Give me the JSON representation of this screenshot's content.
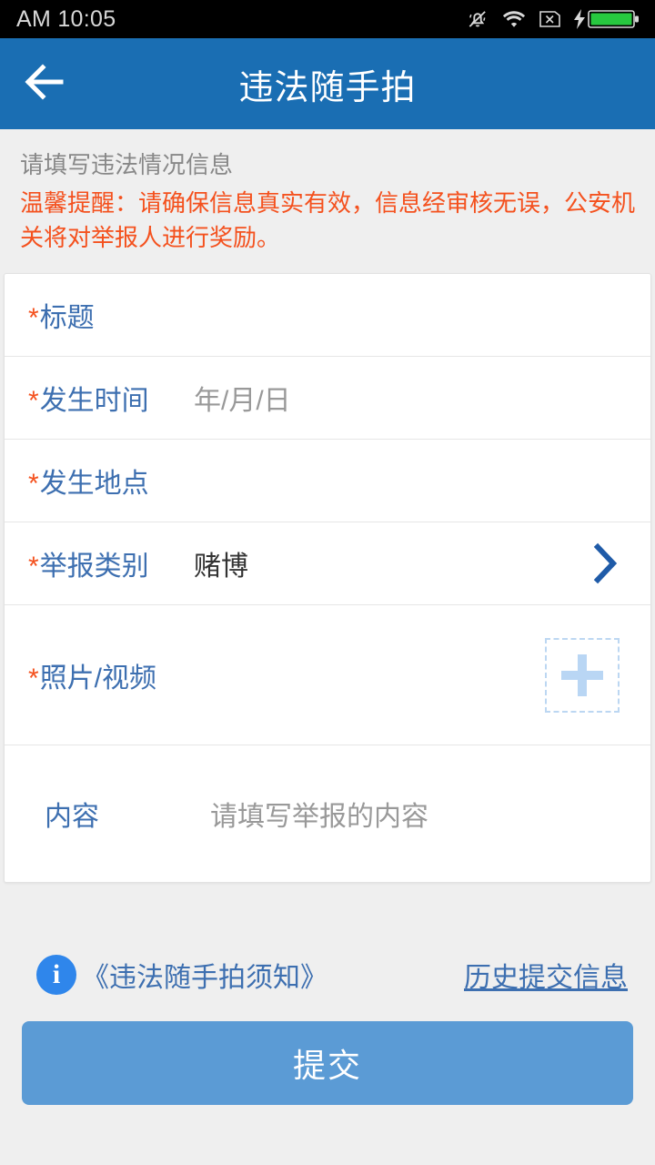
{
  "status_bar": {
    "time": "AM 10:05",
    "icons": [
      "mute-bell-icon",
      "wifi-icon",
      "sim-card-x-icon",
      "charging-bolt-icon",
      "battery-icon"
    ],
    "battery_color": "#27c93f"
  },
  "header": {
    "title": "违法随手拍",
    "back_icon": "arrow-left-icon",
    "background_color": "#1a6eb3"
  },
  "notice": {
    "title": "请填写违法情况信息",
    "warning": "温馨提醒：请确保信息真实有效，信息经审核无误，公安机关将对举报人进行奖励。",
    "warning_color": "#f4511e",
    "title_color": "#888888"
  },
  "form": {
    "required_marker": "*",
    "label_color": "#3d6fb0",
    "rows": [
      {
        "label": "标题",
        "required": true,
        "value": "",
        "placeholder": ""
      },
      {
        "label": "发生时间",
        "required": true,
        "value": "",
        "placeholder": "年/月/日"
      },
      {
        "label": "发生地点",
        "required": true,
        "value": "",
        "placeholder": ""
      },
      {
        "label": "举报类别",
        "required": true,
        "value": "赌博",
        "chevron": "chevron-right-icon"
      },
      {
        "label": "照片/视频",
        "required": true,
        "add_icon": "plus-icon"
      },
      {
        "label": "内容",
        "required": false,
        "placeholder": "请填写举报的内容"
      }
    ]
  },
  "footer": {
    "notice_link": "《违法随手拍须知》",
    "info_icon": "info-circle-icon",
    "history_link": "历史提交信息"
  },
  "submit": {
    "label": "提交",
    "color": "#5b9bd5"
  }
}
